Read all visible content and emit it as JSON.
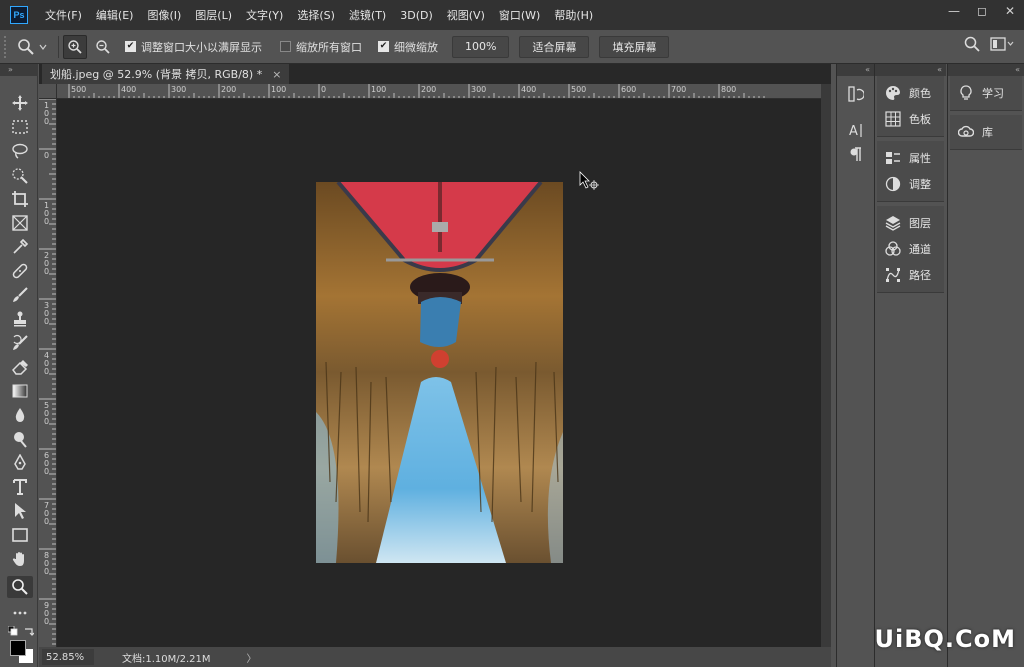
{
  "app": {
    "logo": "Ps"
  },
  "menu": [
    "文件(F)",
    "编辑(E)",
    "图像(I)",
    "图层(L)",
    "文字(Y)",
    "选择(S)",
    "滤镜(T)",
    "3D(D)",
    "视图(V)",
    "窗口(W)",
    "帮助(H)"
  ],
  "window_controls": {
    "minimize": "—",
    "restore": "◻",
    "close": "✕"
  },
  "options": {
    "resize_windows": "调整窗口大小以满屏显示",
    "resize_windows_checked": true,
    "zoom_all": "缩放所有窗口",
    "zoom_all_checked": false,
    "scrubby_zoom": "细微缩放",
    "scrubby_zoom_checked": true,
    "btn_100": "100%",
    "btn_fit": "适合屏幕",
    "btn_fill": "填充屏幕"
  },
  "document": {
    "tab_title": "划船.jpeg @ 52.9% (背景 拷贝, RGB/8) *",
    "close": "×"
  },
  "ruler": {
    "h_labels": [
      "500",
      "400",
      "300",
      "200",
      "100",
      "0",
      "100",
      "200",
      "300",
      "400",
      "500",
      "600",
      "700",
      "800"
    ],
    "v_labels": [
      "100",
      "0",
      "100",
      "200",
      "300",
      "400",
      "500",
      "600",
      "700",
      "800",
      "900"
    ]
  },
  "status": {
    "zoom": "52.85%",
    "doc_info": "文档:1.10M/2.21M",
    "arrow": "〉"
  },
  "panels": {
    "group1": [
      "颜色",
      "色板"
    ],
    "group2": [
      "属性",
      "调整"
    ],
    "group3": [
      "图层",
      "通道",
      "路径"
    ],
    "group4": [
      "学习",
      "库"
    ]
  },
  "collapse_glyph": "«",
  "expand_glyph": "»",
  "watermark": "UiBQ.CoM",
  "colors": {
    "accent": "#31a8ff",
    "canvas": "#262626",
    "panel": "#535353",
    "menubar": "#323232"
  }
}
